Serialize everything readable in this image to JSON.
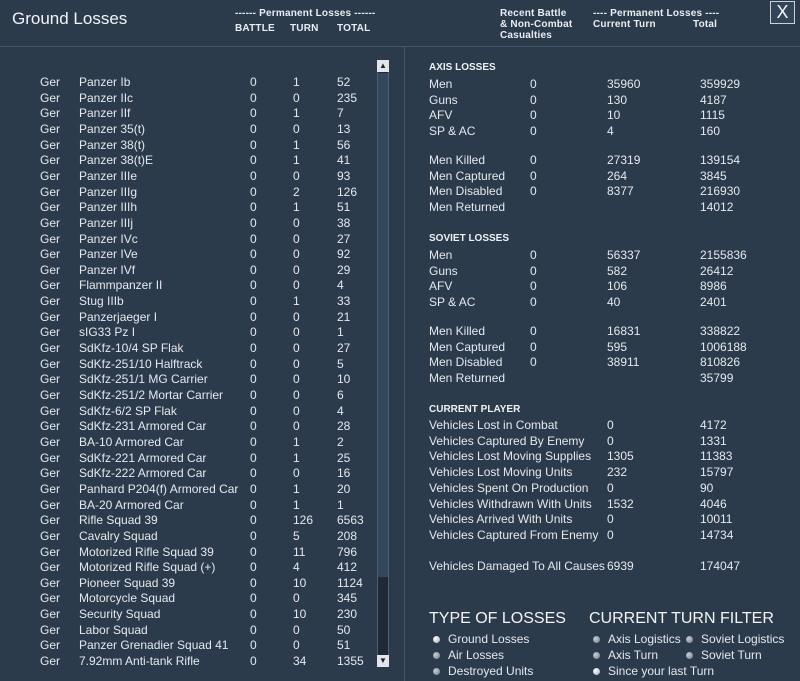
{
  "window": {
    "title": "Ground Losses",
    "close_label": "X"
  },
  "header": {
    "permanent_losses": "------ Permanent Losses ------",
    "col_battle": "BATTLE",
    "col_turn": "TURN",
    "col_total": "TOTAL",
    "recent_battle_1": "Recent Battle",
    "recent_battle_2": "& Non-Combat",
    "recent_battle_3": "Casualties",
    "right_permanent": "---- Permanent Losses ----",
    "current_turn": "Current Turn",
    "total": "Total"
  },
  "units": [
    [
      "Ger",
      "Panzer Ib",
      "0",
      "1",
      "52"
    ],
    [
      "Ger",
      "Panzer IIc",
      "0",
      "0",
      "235"
    ],
    [
      "Ger",
      "Panzer IIf",
      "0",
      "1",
      "7"
    ],
    [
      "Ger",
      "Panzer 35(t)",
      "0",
      "0",
      "13"
    ],
    [
      "Ger",
      "Panzer 38(t)",
      "0",
      "1",
      "56"
    ],
    [
      "Ger",
      "Panzer 38(t)E",
      "0",
      "1",
      "41"
    ],
    [
      "Ger",
      "Panzer IIIe",
      "0",
      "0",
      "93"
    ],
    [
      "Ger",
      "Panzer IIIg",
      "0",
      "2",
      "126"
    ],
    [
      "Ger",
      "Panzer IIIh",
      "0",
      "1",
      "51"
    ],
    [
      "Ger",
      "Panzer IIIj",
      "0",
      "0",
      "38"
    ],
    [
      "Ger",
      "Panzer IVc",
      "0",
      "0",
      "27"
    ],
    [
      "Ger",
      "Panzer IVe",
      "0",
      "0",
      "92"
    ],
    [
      "Ger",
      "Panzer IVf",
      "0",
      "0",
      "29"
    ],
    [
      "Ger",
      "Flammpanzer II",
      "0",
      "0",
      "4"
    ],
    [
      "Ger",
      "Stug IIIb",
      "0",
      "1",
      "33"
    ],
    [
      "Ger",
      "Panzerjaeger I",
      "0",
      "0",
      "21"
    ],
    [
      "Ger",
      "sIG33 Pz I",
      "0",
      "0",
      "1"
    ],
    [
      "Ger",
      "SdKfz-10/4 SP Flak",
      "0",
      "0",
      "27"
    ],
    [
      "Ger",
      "SdKfz-251/10 Halftrack",
      "0",
      "0",
      "5"
    ],
    [
      "Ger",
      "SdKfz-251/1 MG Carrier",
      "0",
      "0",
      "10"
    ],
    [
      "Ger",
      "SdKfz-251/2 Mortar Carrier",
      "0",
      "0",
      "6"
    ],
    [
      "Ger",
      "SdKfz-6/2 SP Flak",
      "0",
      "0",
      "4"
    ],
    [
      "Ger",
      "SdKfz-231 Armored Car",
      "0",
      "0",
      "28"
    ],
    [
      "Ger",
      "BA-10 Armored Car",
      "0",
      "1",
      "2"
    ],
    [
      "Ger",
      "SdKfz-221 Armored Car",
      "0",
      "1",
      "25"
    ],
    [
      "Ger",
      "SdKfz-222 Armored Car",
      "0",
      "0",
      "16"
    ],
    [
      "Ger",
      "Panhard P204(f) Armored Car",
      "0",
      "1",
      "20"
    ],
    [
      "Ger",
      "BA-20 Armored Car",
      "0",
      "1",
      "1"
    ],
    [
      "Ger",
      "Rifle Squad 39",
      "0",
      "126",
      "6563"
    ],
    [
      "Ger",
      "Cavalry Squad",
      "0",
      "5",
      "208"
    ],
    [
      "Ger",
      "Motorized Rifle Squad 39",
      "0",
      "11",
      "796"
    ],
    [
      "Ger",
      "Motorized Rifle Squad (+)",
      "0",
      "4",
      "412"
    ],
    [
      "Ger",
      "Pioneer Squad 39",
      "0",
      "10",
      "1124"
    ],
    [
      "Ger",
      "Motorcycle Squad",
      "0",
      "0",
      "345"
    ],
    [
      "Ger",
      "Security Squad",
      "0",
      "10",
      "230"
    ],
    [
      "Ger",
      "Labor Squad",
      "0",
      "0",
      "50"
    ],
    [
      "Ger",
      "Panzer Grenadier Squad 41",
      "0",
      "0",
      "51"
    ],
    [
      "Ger",
      "7.92mm Anti-tank Rifle",
      "0",
      "34",
      "1355"
    ]
  ],
  "axis": {
    "title": "AXIS LOSSES",
    "rows1": [
      [
        "Men",
        "0",
        "35960",
        "359929"
      ],
      [
        "Guns",
        "0",
        "130",
        "4187"
      ],
      [
        "AFV",
        "0",
        "10",
        "1115"
      ],
      [
        "SP & AC",
        "0",
        "4",
        "160"
      ]
    ],
    "rows2": [
      [
        "Men Killed",
        "0",
        "27319",
        "139154"
      ],
      [
        "Men Captured",
        "0",
        "264",
        "3845"
      ],
      [
        "Men Disabled",
        "0",
        "8377",
        "216930"
      ],
      [
        "Men Returned",
        "",
        "",
        "14012"
      ]
    ]
  },
  "soviet": {
    "title": "SOVIET LOSSES",
    "rows1": [
      [
        "Men",
        "0",
        "56337",
        "2155836"
      ],
      [
        "Guns",
        "0",
        "582",
        "26412"
      ],
      [
        "AFV",
        "0",
        "106",
        "8986"
      ],
      [
        "SP & AC",
        "0",
        "40",
        "2401"
      ]
    ],
    "rows2": [
      [
        "Men Killed",
        "0",
        "16831",
        "338822"
      ],
      [
        "Men Captured",
        "0",
        "595",
        "1006188"
      ],
      [
        "Men Disabled",
        "0",
        "38911",
        "810826"
      ],
      [
        "Men Returned",
        "",
        "",
        "35799"
      ]
    ]
  },
  "current_player": {
    "title": "CURRENT PLAYER",
    "rows": [
      [
        "Vehicles Lost in Combat",
        "0",
        "4172"
      ],
      [
        "Vehicles Captured By Enemy",
        "0",
        "1331"
      ],
      [
        "Vehicles Lost Moving Supplies",
        "1305",
        "11383"
      ],
      [
        "Vehicles Lost Moving Units",
        "232",
        "15797"
      ],
      [
        "Vehicles Spent On Production",
        "0",
        "90"
      ],
      [
        "Vehicles Withdrawn With Units",
        "1532",
        "4046"
      ],
      [
        "Vehicles Arrived With Units",
        "0",
        "10011"
      ],
      [
        "Vehicles Captured From Enemy",
        "0",
        "14734"
      ]
    ],
    "damaged": [
      "Vehicles Damaged To All Causes",
      "6939",
      "174047"
    ]
  },
  "filters": {
    "type_title": "TYPE OF LOSSES",
    "turn_title": "CURRENT TURN FILTER",
    "type_options": [
      "Ground Losses",
      "Air Losses",
      "Destroyed Units"
    ],
    "turn_options": [
      "Axis Logistics",
      "Soviet Logistics",
      "Axis Turn",
      "Soviet Turn",
      "Since your last Turn"
    ]
  }
}
